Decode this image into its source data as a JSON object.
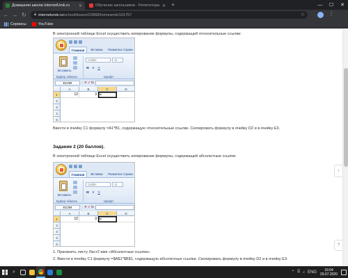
{
  "browser": {
    "tabs": [
      {
        "title": "Домашняя школа InternetUrok.ru",
        "active": true,
        "favicon_color": "#2e7d32"
      },
      {
        "title": "Обучение школьников · Репетиторы",
        "active": false,
        "favicon_color": "#e53935"
      }
    ],
    "new_tab": "+",
    "url_host": "interneturok.ru",
    "url_path": "/school/lesson/22868/homework/101757",
    "bookmarks": [
      {
        "label": "Сервисы",
        "icon": "apps-icon"
      },
      {
        "label": "YouTube",
        "icon": "youtube-icon"
      }
    ]
  },
  "content": {
    "task1_intro": "В электронной таблице Excel осуществить копирование формулы, содержащей относительные ссылки:",
    "task1_instruction": "Ввести в ячейку C1 формулу =A1*B1, содержащую относительные ссылки. Скопировать формулу в ячейку D2 и в ячейку E3.",
    "task2_heading": "Задание 2 (20 баллов).",
    "task2_intro": "В электронной таблице Excel осуществить копирование формулы, содержащей абсолютные ссылки:",
    "task2_items": [
      "1. Присвоить листу Лист2 имя «Абсолютные ссылки».",
      "2. Ввести в ячейку C1 формулу =$A$1*$B$1, содержащую абсолютные ссылки. Скопировать формулу в ячейку D2 и в ячейку E3."
    ]
  },
  "excel": {
    "tabs": [
      "Главная",
      "Вставка",
      "Разметка страни"
    ],
    "paste_label": "Вставить",
    "font_name": "Calibri",
    "font_size": "11",
    "bold": "Ж",
    "italic": "К",
    "underline": "Ч",
    "group_clipboard": "Буфер обмена",
    "group_font": "Шрифт",
    "namebox": "ЕСЛИ",
    "fx_icons": "✕ ✓ fx",
    "columns": [
      "A",
      "B",
      "C",
      "D"
    ],
    "rows": [
      "1",
      "2",
      "3",
      "4",
      "5"
    ],
    "cell_a1": "12",
    "cell_b1": "3",
    "cell_c1": "=",
    "accent": "#f8d98b"
  },
  "taskbar": {
    "lang": "ENG",
    "time": "16:04",
    "date": "29.07.2020"
  },
  "colors": {
    "chrome_dark": "#202124",
    "chrome_toolbar": "#35363a",
    "excel_ribbon": "#dfe9f5",
    "taskbar": "#1f1f1f"
  }
}
